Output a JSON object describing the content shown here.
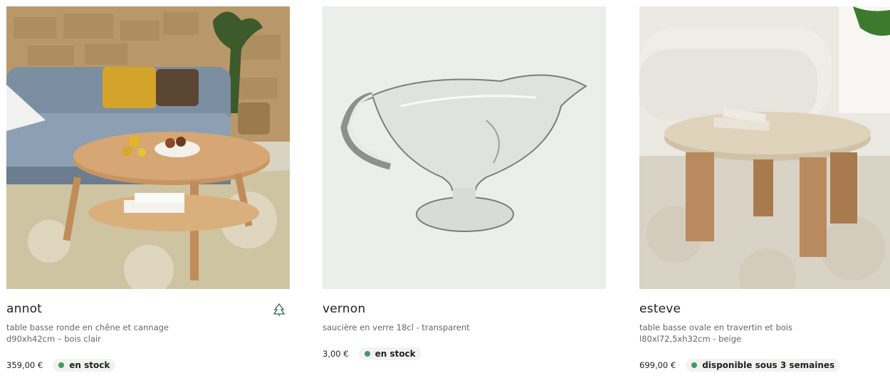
{
  "products": [
    {
      "name": "annot",
      "description": "table basse ronde en chêne et cannage d90xh42cm – bois clair",
      "price": "359,00 €",
      "availability": "en stock",
      "badge": "FSC",
      "availability_color": "#3f9a63"
    },
    {
      "name": "vernon",
      "description": "saucière en verre 18cl - transparent",
      "price": "3,00 €",
      "availability": "en stock",
      "availability_color": "#3f9a63"
    },
    {
      "name": "esteve",
      "description": "table basse ovale en travertin et bois l80xl72,5xh32cm - beige",
      "price": "699,00 €",
      "availability": "disponible sous 3 semaines",
      "availability_color": "#3f9a63"
    }
  ]
}
